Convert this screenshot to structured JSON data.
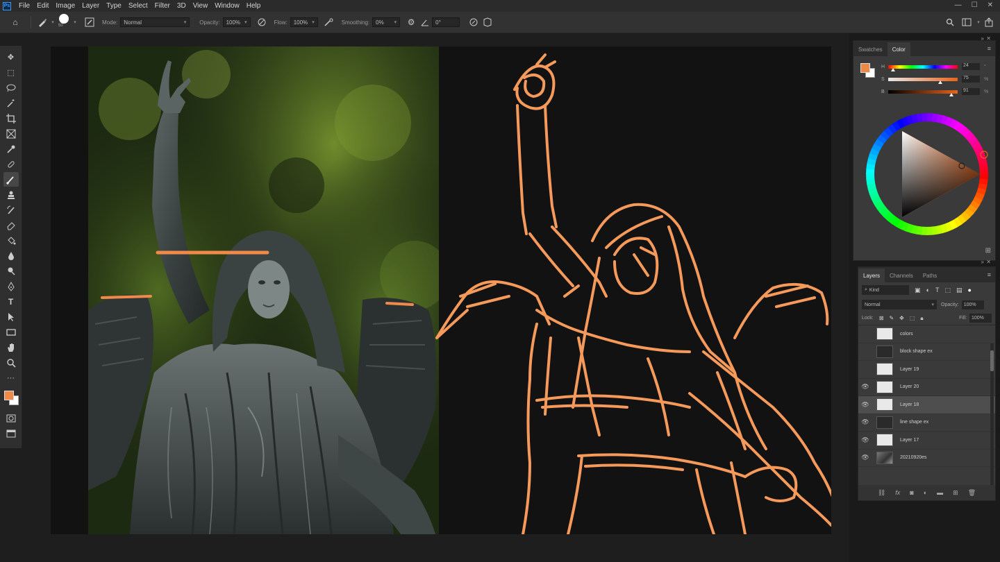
{
  "menubar": {
    "app_icon": "Ps",
    "items": [
      "File",
      "Edit",
      "Image",
      "Layer",
      "Type",
      "Select",
      "Filter",
      "3D",
      "View",
      "Window",
      "Help"
    ]
  },
  "options_bar": {
    "brush_size": "50",
    "mode_label": "Mode:",
    "mode_value": "Normal",
    "opacity_label": "Opacity:",
    "opacity_value": "100%",
    "flow_label": "Flow:",
    "flow_value": "100%",
    "smoothing_label": "Smoothing:",
    "smoothing_value": "0%",
    "angle_value": "0°"
  },
  "toolbar": {
    "tools": [
      "move-icon",
      "marquee-icon",
      "lasso-icon",
      "magic-wand-icon",
      "crop-icon",
      "frame-icon",
      "eyedropper-icon",
      "healing-icon",
      "brush-icon",
      "clone-stamp-icon",
      "history-brush-icon",
      "eraser-icon",
      "paint-bucket-icon",
      "blur-icon",
      "dodge-icon",
      "pen-icon",
      "type-icon",
      "path-select-icon",
      "rectangle-icon",
      "hand-icon",
      "zoom-icon",
      "more-icon"
    ],
    "active_tool": "brush-icon",
    "foreground_color": "#f08a4b",
    "background_color": "#ffffff"
  },
  "color_panel": {
    "tabs": [
      "Swatches",
      "Color"
    ],
    "active_tab": "Color",
    "h_label": "H",
    "s_label": "S",
    "b_label": "B",
    "h_value": "24",
    "s_value": "75",
    "b_value": "91",
    "h_unit": "°",
    "s_unit": "%",
    "b_unit": "%",
    "current_color": "#e88a4a",
    "h_fraction": 0.07,
    "s_fraction": 0.75,
    "b_fraction": 0.91
  },
  "layers_panel": {
    "tabs": [
      "Layers",
      "Channels",
      "Paths"
    ],
    "active_tab": "Layers",
    "kind_label": "Kind",
    "blend_mode": "Normal",
    "opacity_label": "Opacity:",
    "opacity_value": "100%",
    "lock_label": "Lock:",
    "fill_label": "Fill:",
    "fill_value": "100%",
    "layers": [
      {
        "name": "colors",
        "visible": false,
        "thumb": "light",
        "selected": false
      },
      {
        "name": "block shape ex",
        "visible": false,
        "thumb": "dark",
        "selected": false
      },
      {
        "name": "Layer 19",
        "visible": false,
        "thumb": "light",
        "selected": false
      },
      {
        "name": "Layer 20",
        "visible": true,
        "thumb": "light",
        "selected": false
      },
      {
        "name": "Layer 18",
        "visible": true,
        "thumb": "light",
        "selected": true
      },
      {
        "name": "line shape ex",
        "visible": true,
        "thumb": "dark",
        "selected": false
      },
      {
        "name": "Layer 17",
        "visible": true,
        "thumb": "light",
        "selected": false
      },
      {
        "name": "20210920es",
        "visible": true,
        "thumb": "photo",
        "selected": false
      }
    ]
  },
  "sketch": {
    "stroke_color": "#f59a5a"
  }
}
